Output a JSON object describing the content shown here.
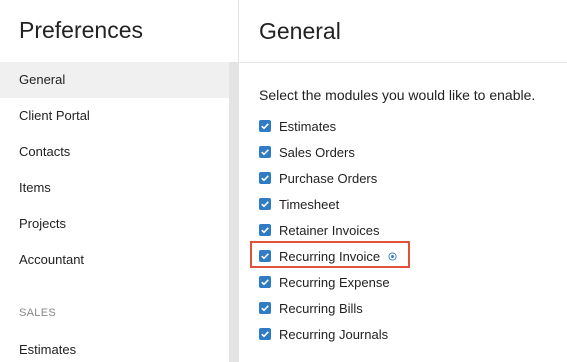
{
  "sidebar": {
    "title": "Preferences",
    "items": [
      {
        "label": "General"
      },
      {
        "label": "Client Portal"
      },
      {
        "label": "Contacts"
      },
      {
        "label": "Items"
      },
      {
        "label": "Projects"
      },
      {
        "label": "Accountant"
      }
    ],
    "section_label": "SALES",
    "section_items": [
      {
        "label": "Estimates"
      }
    ]
  },
  "main": {
    "title": "General",
    "subtitle": "Select the modules you would like to enable.",
    "modules": [
      {
        "label": "Estimates",
        "checked": true
      },
      {
        "label": "Sales Orders",
        "checked": true
      },
      {
        "label": "Purchase Orders",
        "checked": true
      },
      {
        "label": "Timesheet",
        "checked": true
      },
      {
        "label": "Retainer Invoices",
        "checked": true
      },
      {
        "label": "Recurring Invoice",
        "checked": true,
        "icon": "settings-dot-icon"
      },
      {
        "label": "Recurring Expense",
        "checked": true
      },
      {
        "label": "Recurring Bills",
        "checked": true
      },
      {
        "label": "Recurring Journals",
        "checked": true
      }
    ]
  },
  "colors": {
    "checkbox": "#2f7cc4",
    "highlight": "#e0533a",
    "active_item_bg": "#f0f0f0"
  }
}
